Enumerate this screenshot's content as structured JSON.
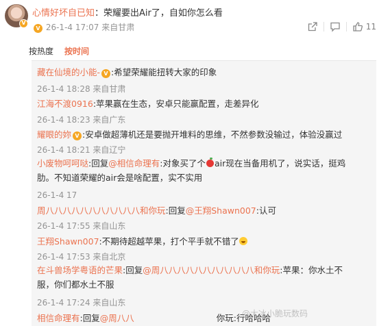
{
  "post": {
    "author": "心情好坏自已知",
    "separator": "：",
    "text": "荣耀要出Air了，自如你怎么看",
    "time": "26-1-4 17:07",
    "location": "来自甘肃",
    "like_count": "11",
    "icons": {
      "share": "share-icon",
      "comment": "comment-icon",
      "like": "thumbs-up-icon"
    }
  },
  "sort": {
    "by_heat": "按热度",
    "by_time": "按时间"
  },
  "replies": [
    {
      "author": "藏在仙境的小能-",
      "text": ":希望荣耀能扭转大家的印象",
      "time": "26-1-4 18:28 来自甘肃"
    },
    {
      "author": "江海不渡0916",
      "text": ":苹果赢在生态，安卓只能赢配置，走差异化",
      "time": "26-1-4 18:23 来自广东"
    },
    {
      "author": "耀眼的妳",
      "text": ":安卓做超薄机还是要抛开堆料的思维，不然参数没输过，体验没赢过",
      "time": "26-1-4 18:21 来自辽宁"
    },
    {
      "author": "小废物呵呵哒",
      "reply_word": ":回复",
      "mention": "@相信命理有",
      "text_a": ":对象买了个",
      "text_b": "air现在当备用机了，说实话，挺鸡",
      "text_c": "肋。不知道荣耀的air会是啥配置，实不实用",
      "time": "26-1-4 17"
    },
    {
      "author": "周八八八八八八八八八八八和你玩",
      "reply_word": ":回复",
      "mention": "@王翔Shawn007",
      "text": ":认可",
      "time": "26-1-4 17:55 来自山东"
    },
    {
      "author": "王翔Shawn007",
      "text": ":不期待超越苹果，打个平手就不错了",
      "time": "26-1-4 17:53 来自北京"
    },
    {
      "author": "在斗兽场学粤语的芒果",
      "reply_word": ":回复",
      "mention": "@周八八八八八八八八八八八和你玩",
      "text_a": ":苹果：你水土不",
      "text_b": "服，你们都水土不服",
      "time": "26-1-4 17:24 来自山东"
    },
    {
      "author": "相信命理有",
      "reply_word": ":回复",
      "mention": "@周八八",
      "text": "你玩:行哈哈哈"
    }
  ],
  "colors": {
    "accent": "#eb7350",
    "link": "#2f6bb5",
    "meta": "#939393",
    "badge": "#f5a623"
  },
  "watermark": "@大冰小脆玩数码"
}
